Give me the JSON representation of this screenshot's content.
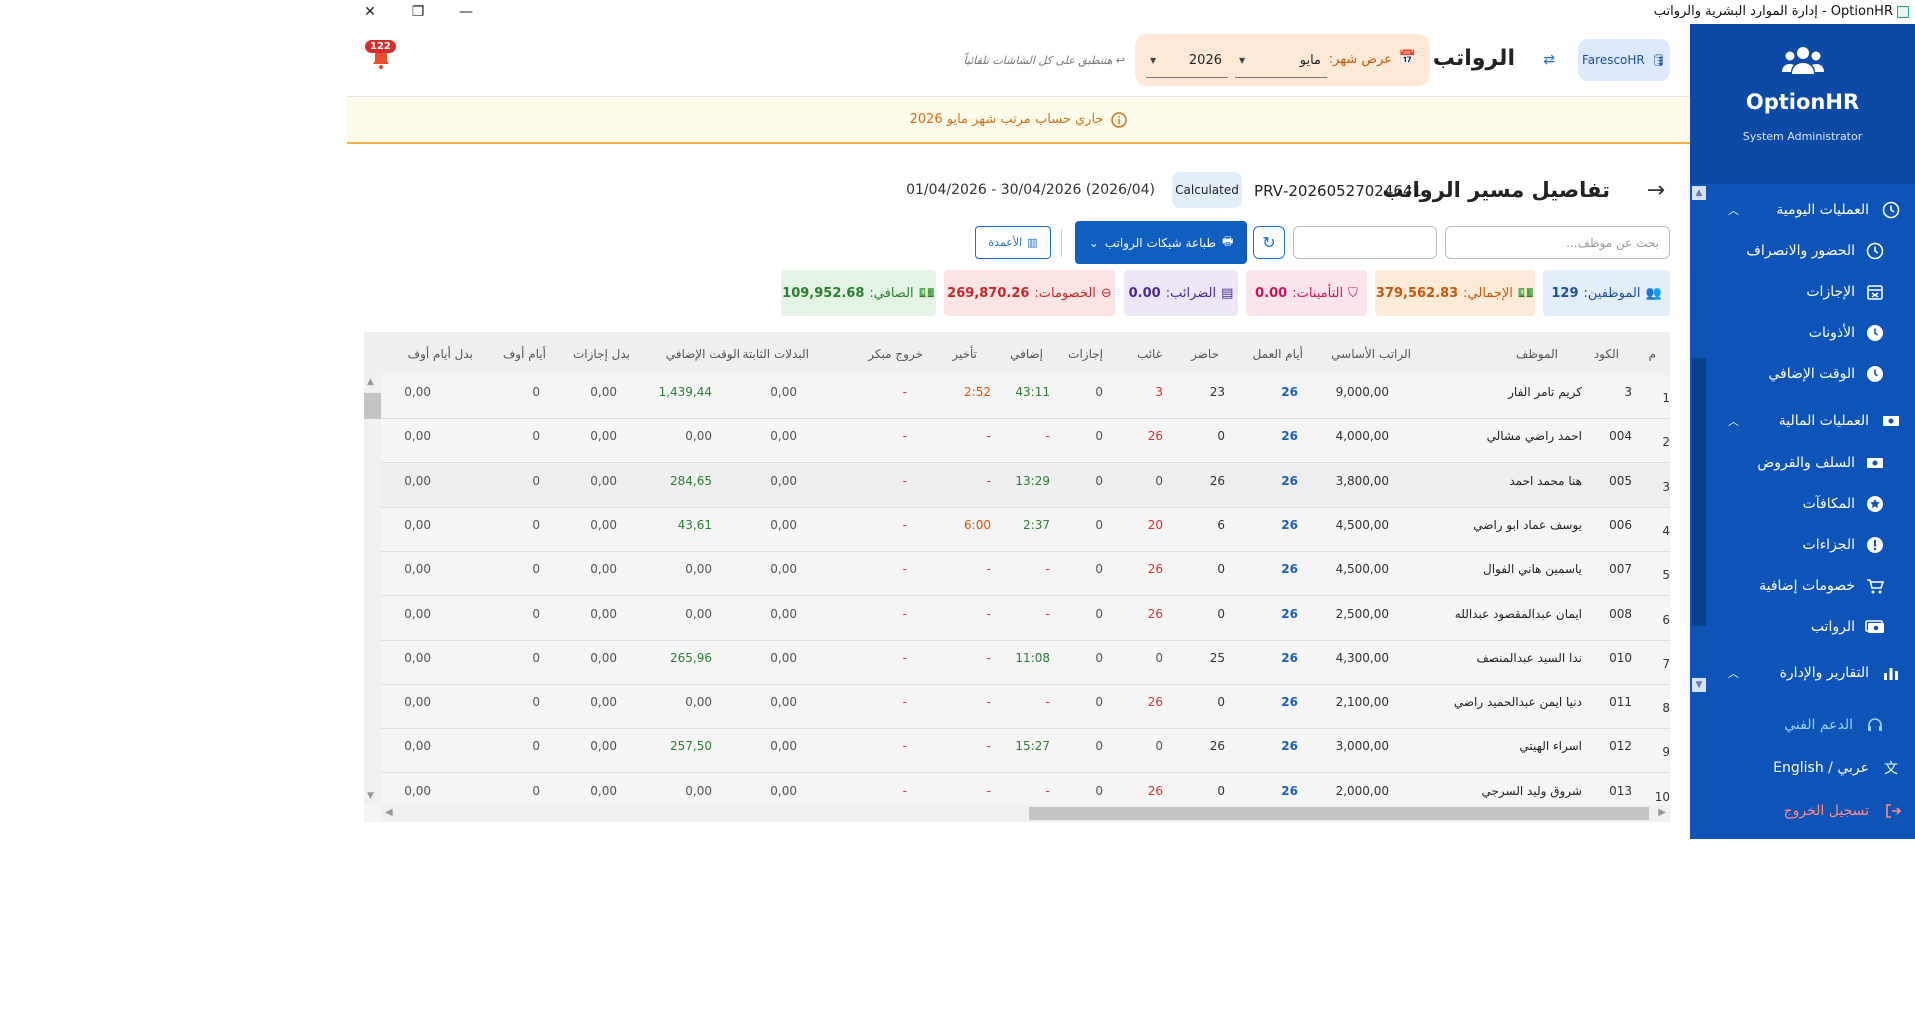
{
  "window": {
    "title": "OptionHR - إدارة الموارد البشرية والرواتب"
  },
  "sidebar": {
    "brand": "OptionHR",
    "role": "System Administrator",
    "sections": [
      {
        "label": "العمليات اليومية",
        "icon": "clock-icon"
      },
      {
        "label": "العمليات المالية",
        "icon": "money-icon"
      },
      {
        "label": "التقارير والإدارة",
        "icon": "chart-icon"
      }
    ],
    "daily_items": [
      {
        "label": "الحضور والانصراف",
        "icon": "clock-icon"
      },
      {
        "label": "الإجازات",
        "icon": "calendar-x-icon"
      },
      {
        "label": "الأذونات",
        "icon": "clock-alert-icon"
      },
      {
        "label": "الوقت الإضافي",
        "icon": "clock-plus-icon"
      }
    ],
    "finance_items": [
      {
        "label": "السلف والقروض",
        "icon": "money-icon"
      },
      {
        "label": "المكافآت",
        "icon": "star-icon"
      },
      {
        "label": "الجزاءات",
        "icon": "alert-icon"
      },
      {
        "label": "خصومات إضافية",
        "icon": "cart-icon"
      },
      {
        "label": "الرواتب",
        "icon": "payroll-icon"
      }
    ],
    "support": "الدعم الفني",
    "language": "عربي / English",
    "logout": "تسجيل الخروج"
  },
  "header": {
    "db_label": "FarescoHR",
    "title": "الرواتب",
    "month_label": "عرض شهر:",
    "month_value": "مايو",
    "year_value": "2026",
    "apply_note": "↩ هتنطبق على كل الشاشات تلقائياً",
    "notifications": "122"
  },
  "alert": {
    "text": "جاري حساب مرتب شهر مايو 2026"
  },
  "detail": {
    "title": "تفاصيل مسير الرواتب",
    "run_id": "20260527024641-PRV",
    "status": "Calculated",
    "period": "(2026/04) 30/04/2026 - 01/04/2026"
  },
  "toolbar": {
    "search_placeholder": "بحث عن موظف...",
    "print_label": "طباعة شيكات الرواتب",
    "columns_label": "الأعمدة"
  },
  "summary": {
    "employees_label": "الموظفين:",
    "employees_value": "129",
    "gross_label": "الإجمالي:",
    "gross_value": "379,562.83",
    "insurance_label": "التأمينات:",
    "insurance_value": "0.00",
    "taxes_label": "الضرائب:",
    "taxes_value": "0.00",
    "deductions_label": "الخصومات:",
    "deductions_value": "269,870.26",
    "net_label": "الصافي:",
    "net_value": "109,952.68",
    "colors": {
      "employees": "#1d4f9a",
      "gross": "#c25a10",
      "insurance": "#c2185b",
      "taxes": "#4a2a8f",
      "deductions": "#c62828",
      "net": "#2e7d32"
    }
  },
  "table": {
    "columns": [
      "م",
      "الكود",
      "الموظف",
      "الراتب الأساسي",
      "أيام العمل",
      "حاضر",
      "غائب",
      "إجازات",
      "إضافي",
      "تأخير",
      "خروج مبكر",
      "البدلات الثابتة",
      "الوقت الإضافي",
      "بدل إجازات",
      "أيام أوف",
      "بدل أيام أوف"
    ],
    "rows": [
      [
        "1",
        "3",
        "كريم تامر الفار",
        "9,000,00",
        "26",
        "23",
        "3",
        "0",
        "43:11",
        "2:52",
        "-",
        "0,00",
        "1,439,44",
        "0,00",
        "0",
        "0,00"
      ],
      [
        "2",
        "004",
        "احمد راضي مشالي",
        "4,000,00",
        "26",
        "0",
        "26",
        "0",
        "-",
        "-",
        "-",
        "0,00",
        "0,00",
        "0,00",
        "0",
        "0,00"
      ],
      [
        "3",
        "005",
        "هنا محمد احمد",
        "3,800,00",
        "26",
        "26",
        "0",
        "0",
        "13:29",
        "-",
        "-",
        "0,00",
        "284,65",
        "0,00",
        "0",
        "0,00"
      ],
      [
        "4",
        "006",
        "يوسف عماد ابو راضي",
        "4,500,00",
        "26",
        "6",
        "20",
        "0",
        "2:37",
        "6:00",
        "-",
        "0,00",
        "43,61",
        "0,00",
        "0",
        "0,00"
      ],
      [
        "5",
        "007",
        "ياسمين هاني الفوال",
        "4,500,00",
        "26",
        "0",
        "26",
        "0",
        "-",
        "-",
        "-",
        "0,00",
        "0,00",
        "0,00",
        "0",
        "0,00"
      ],
      [
        "6",
        "008",
        "ايمان عبدالمقصود عبدالله",
        "2,500,00",
        "26",
        "0",
        "26",
        "0",
        "-",
        "-",
        "-",
        "0,00",
        "0,00",
        "0,00",
        "0",
        "0,00"
      ],
      [
        "7",
        "010",
        "ندا السيد عبدالمنصف",
        "4,300,00",
        "26",
        "25",
        "0",
        "0",
        "11:08",
        "-",
        "-",
        "0,00",
        "265,96",
        "0,00",
        "0",
        "0,00"
      ],
      [
        "8",
        "011",
        "دنيا ايمن عبدالحميد راضي",
        "2,100,00",
        "26",
        "0",
        "26",
        "0",
        "-",
        "-",
        "-",
        "0,00",
        "0,00",
        "0,00",
        "0",
        "0,00"
      ],
      [
        "9",
        "012",
        "اسراء الهيتي",
        "3,000,00",
        "26",
        "26",
        "0",
        "0",
        "15:27",
        "-",
        "-",
        "0,00",
        "257,50",
        "0,00",
        "0",
        "0,00"
      ],
      [
        "10",
        "013",
        "شروق وليد السرجي",
        "2,000,00",
        "26",
        "0",
        "26",
        "0",
        "-",
        "-",
        "-",
        "0,00",
        "0,00",
        "0,00",
        "0",
        "0,00"
      ]
    ]
  }
}
